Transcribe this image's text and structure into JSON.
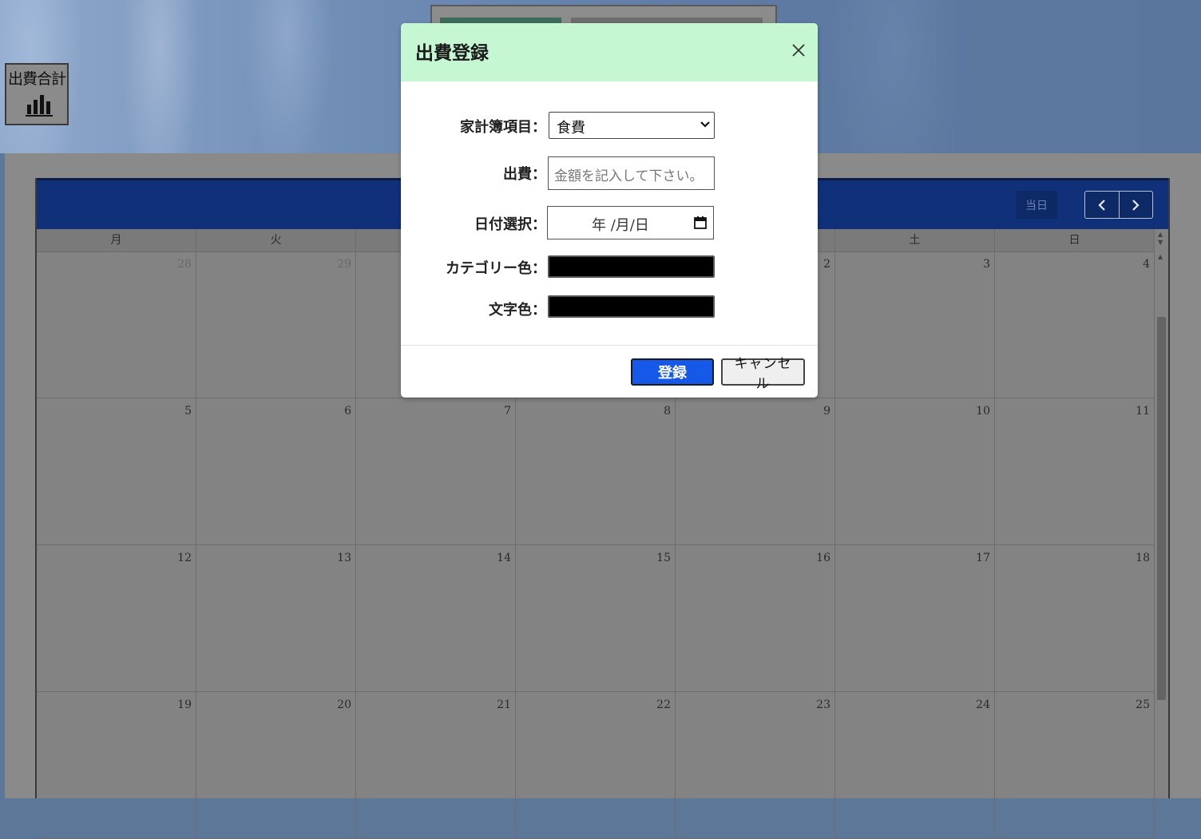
{
  "toolbar": {
    "expense_total_label": "出費合計"
  },
  "calendar": {
    "today_label": "当日",
    "weekdays": [
      "月",
      "火",
      "",
      "",
      "",
      "土",
      "日"
    ],
    "weeks": [
      [
        "28",
        "29",
        "",
        "",
        "2",
        "3",
        "4"
      ],
      [
        "5",
        "6",
        "7",
        "8",
        "9",
        "10",
        "11"
      ],
      [
        "12",
        "13",
        "14",
        "15",
        "16",
        "17",
        "18"
      ],
      [
        "19",
        "20",
        "21",
        "22",
        "23",
        "24",
        "25"
      ]
    ]
  },
  "modal": {
    "title": "出費登録",
    "fields": {
      "category_label": "家計簿項目：",
      "category_value": "食費",
      "amount_label": "出費：",
      "amount_placeholder": "金額を記入して下さい。",
      "date_label": "日付選択：",
      "date_placeholder": "年 /月/日",
      "category_color_label": "カテゴリー色：",
      "category_color_value": "#000000",
      "text_color_label": "文字色：",
      "text_color_value": "#000000"
    },
    "register_label": "登録",
    "cancel_label": "キャンセル"
  },
  "colors": {
    "modal_header": "#c5f7d2",
    "calendar_header": "#10307a",
    "register_button": "#1659e8"
  }
}
